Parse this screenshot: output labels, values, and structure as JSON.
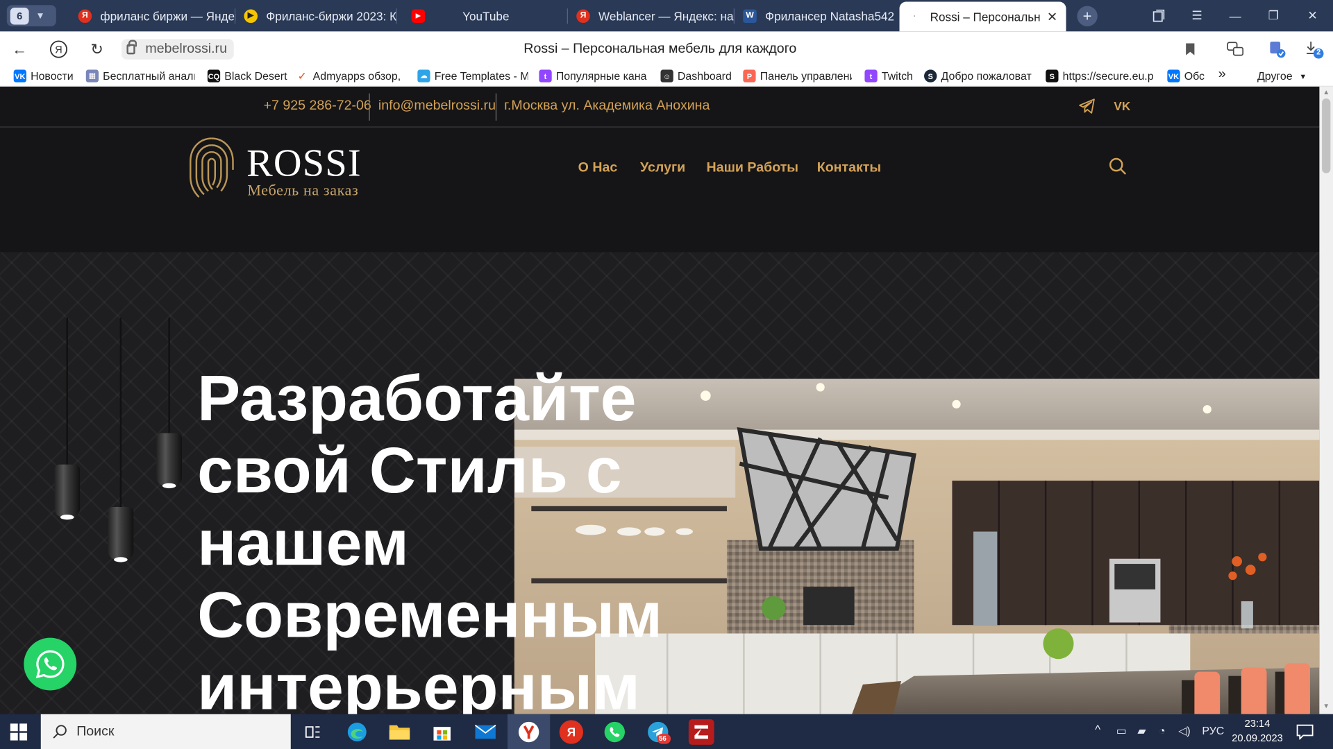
{
  "browser": {
    "tab_count": "6",
    "tabs": [
      {
        "title": "фриланс биржи — Яндекс",
        "favicon": "yandex-icon",
        "color": "#e0301e"
      },
      {
        "title": "Фриланс-биржи 2023: К",
        "favicon": "yandex-video-icon",
        "color": "#f7c500"
      },
      {
        "title": "YouTube",
        "favicon": "youtube-icon",
        "color": "#ff0000"
      },
      {
        "title": "Weblancer — Яндекс: на",
        "favicon": "yandex-icon",
        "color": "#e0301e"
      },
      {
        "title": "Фрилансер Natasha542 |",
        "favicon": "word-icon",
        "color": "#2b579a"
      },
      {
        "title": "Rossi – Персональная",
        "favicon": "loading-icon",
        "color": "#cccccc"
      }
    ],
    "url_host": "mebelrossi.ru",
    "page_title": "Rossi – Персональная мебель для каждого",
    "download_count": "2"
  },
  "bookmarks": [
    {
      "label": "Новости",
      "icon": "vk-icon",
      "color": "#0077ff"
    },
    {
      "label": "Бесплатный анали",
      "icon": "grid-icon",
      "color": "#7a86b8"
    },
    {
      "label": "Black Desert",
      "icon": "bdo-icon",
      "color": "#111111"
    },
    {
      "label": "Admyapps обзор,",
      "icon": "check-icon",
      "color": "#e8552c"
    },
    {
      "label": "Free Templates - M",
      "icon": "cloud-icon",
      "color": "#2ea4e8"
    },
    {
      "label": "Популярные кана",
      "icon": "twitch-icon",
      "color": "#9146ff"
    },
    {
      "label": "Dashboard",
      "icon": "chat-icon",
      "color": "#333333"
    },
    {
      "label": "Панель управлени",
      "icon": "patreon-icon",
      "color": "#f96854"
    },
    {
      "label": "Twitch",
      "icon": "twitch-icon",
      "color": "#9146ff"
    },
    {
      "label": "Добро пожаловат",
      "icon": "steam-icon",
      "color": "#1b2838"
    },
    {
      "label": "https://secure.eu.p",
      "icon": "s-icon",
      "color": "#111111"
    },
    {
      "label": "Обс",
      "icon": "vk-icon",
      "color": "#0077ff"
    }
  ],
  "bookmarks_more": "»",
  "bookmarks_other": "Другое",
  "site": {
    "phone": "+7 925 286-72-06",
    "email": "info@mebelrossi.ru",
    "address": "г.Москва ул. Академика Анохина",
    "logo_name": "ROSSI",
    "logo_sub": "Мебель на заказ",
    "nav": [
      "О Нас",
      "Услуги",
      "Наши Работы",
      "Контакты"
    ],
    "hero_title": "Разработайте свой Стиль с нашем Современным интерьерным",
    "accent": "#d4a256"
  },
  "taskbar": {
    "search_placeholder": "Поиск",
    "lang": "РУС",
    "time": "23:14",
    "date": "20.09.2023",
    "telegram_badge": "56"
  }
}
